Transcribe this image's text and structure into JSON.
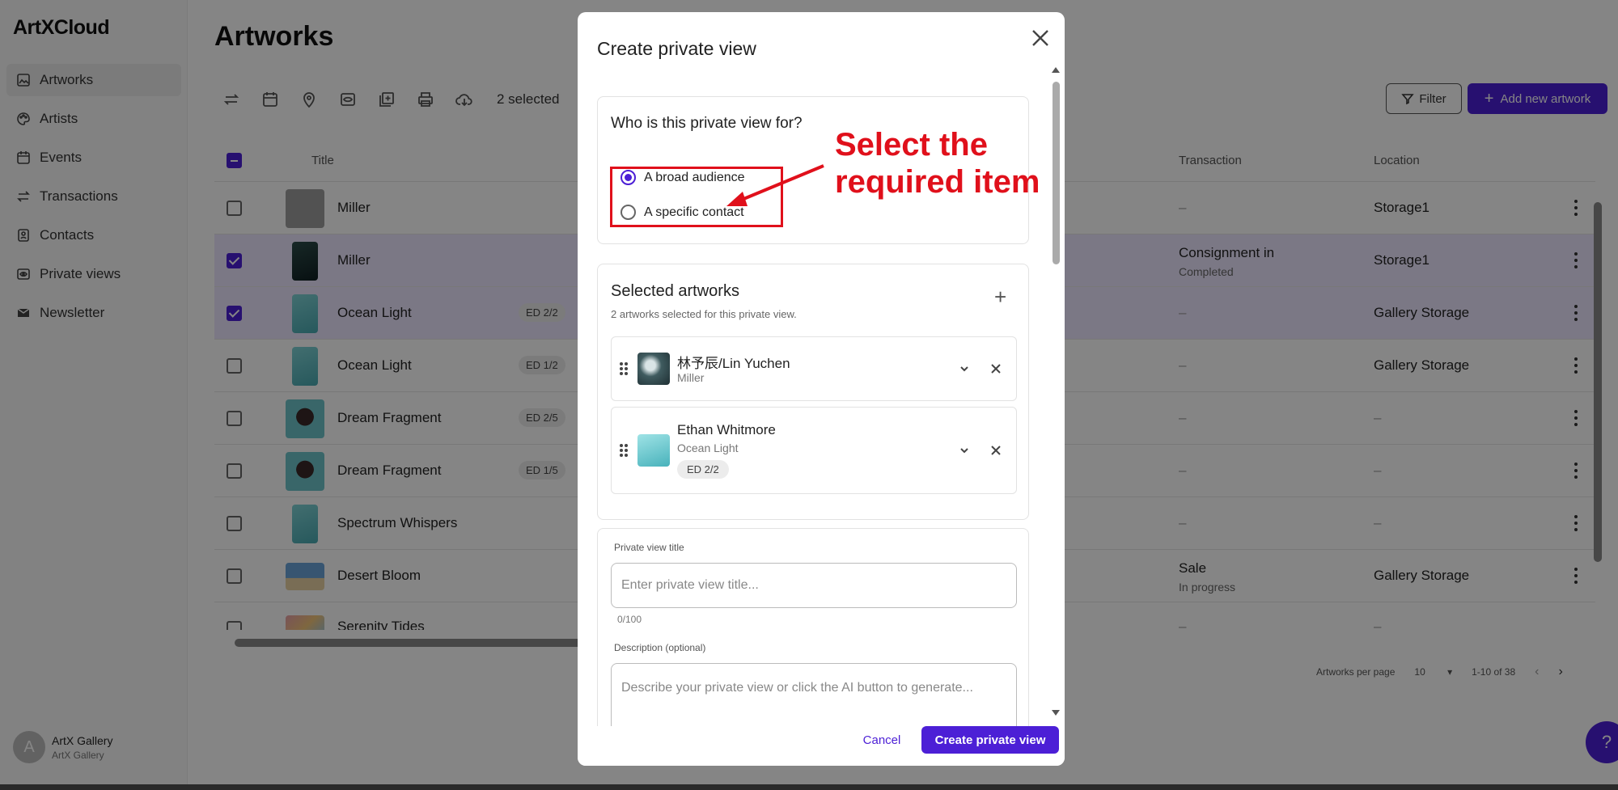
{
  "app": {
    "logo": "ArtXCloud"
  },
  "sidebar": {
    "items": [
      {
        "label": "Artworks",
        "icon": "image-icon",
        "active": true
      },
      {
        "label": "Artists",
        "icon": "palette-icon"
      },
      {
        "label": "Events",
        "icon": "calendar-icon"
      },
      {
        "label": "Transactions",
        "icon": "swap-icon"
      },
      {
        "label": "Contacts",
        "icon": "contact-icon"
      },
      {
        "label": "Private views",
        "icon": "eye-icon"
      },
      {
        "label": "Newsletter",
        "icon": "mail-icon"
      }
    ],
    "user": {
      "initial": "A",
      "name": "ArtX Gallery",
      "org": "ArtX Gallery"
    }
  },
  "main": {
    "title": "Artworks",
    "selected_count": "2 selected",
    "filter_label": "Filter",
    "add_label": "Add new artwork",
    "columns": {
      "title": "Title",
      "transaction": "Transaction",
      "location": "Location"
    },
    "rows": [
      {
        "title": "Miller",
        "ed": "",
        "transaction": "–",
        "transaction_sub": "",
        "location": "Storage1",
        "checked": false
      },
      {
        "title": "Miller",
        "ed": "",
        "transaction": "Consignment in",
        "transaction_sub": "Completed",
        "location": "Storage1",
        "checked": true
      },
      {
        "title": "Ocean Light",
        "ed": "ED 2/2",
        "transaction": "–",
        "transaction_sub": "",
        "location": "Gallery Storage",
        "checked": true
      },
      {
        "title": "Ocean Light",
        "ed": "ED 1/2",
        "transaction": "–",
        "transaction_sub": "",
        "location": "Gallery Storage",
        "checked": false
      },
      {
        "title": "Dream Fragment",
        "ed": "ED 2/5",
        "transaction": "–",
        "transaction_sub": "",
        "location": "–",
        "checked": false
      },
      {
        "title": "Dream Fragment",
        "ed": "ED 1/5",
        "transaction": "–",
        "transaction_sub": "",
        "location": "–",
        "checked": false
      },
      {
        "title": "Spectrum Whispers",
        "ed": "",
        "transaction": "–",
        "transaction_sub": "",
        "location": "–",
        "checked": false
      },
      {
        "title": "Desert Bloom",
        "ed": "",
        "transaction": "Sale",
        "transaction_sub": "In progress",
        "location": "Gallery Storage",
        "checked": false
      },
      {
        "title": "Serenity Tides",
        "ed": "",
        "transaction": "–",
        "transaction_sub": "",
        "location": "–",
        "checked": false
      }
    ],
    "pagination": {
      "per_page_label": "Artworks per page",
      "per_page": "10",
      "range": "1-10 of 38"
    }
  },
  "modal": {
    "title": "Create private view",
    "audience": {
      "question": "Who is this private view for?",
      "options": [
        "A broad audience",
        "A specific contact"
      ],
      "selected": "A broad audience"
    },
    "artworks": {
      "title": "Selected artworks",
      "subtitle": "2 artworks selected for this private view.",
      "items": [
        {
          "artist": "林予辰/Lin Yuchen",
          "title": "Miller",
          "ed": ""
        },
        {
          "artist": "Ethan Whitmore",
          "title": "Ocean Light",
          "ed": "ED 2/2"
        }
      ]
    },
    "form": {
      "title_label": "Private view title",
      "title_placeholder": "Enter private view title...",
      "title_count": "0/100",
      "desc_label": "Description (optional)",
      "desc_placeholder": "Describe your private view or click the AI button to generate..."
    },
    "cancel_label": "Cancel",
    "create_label": "Create private view"
  },
  "annotation": {
    "text_line1": "Select the",
    "text_line2": "required item"
  },
  "help_label": "?",
  "colors": {
    "accent": "#4c1fd6",
    "annotation": "#e0101b"
  }
}
